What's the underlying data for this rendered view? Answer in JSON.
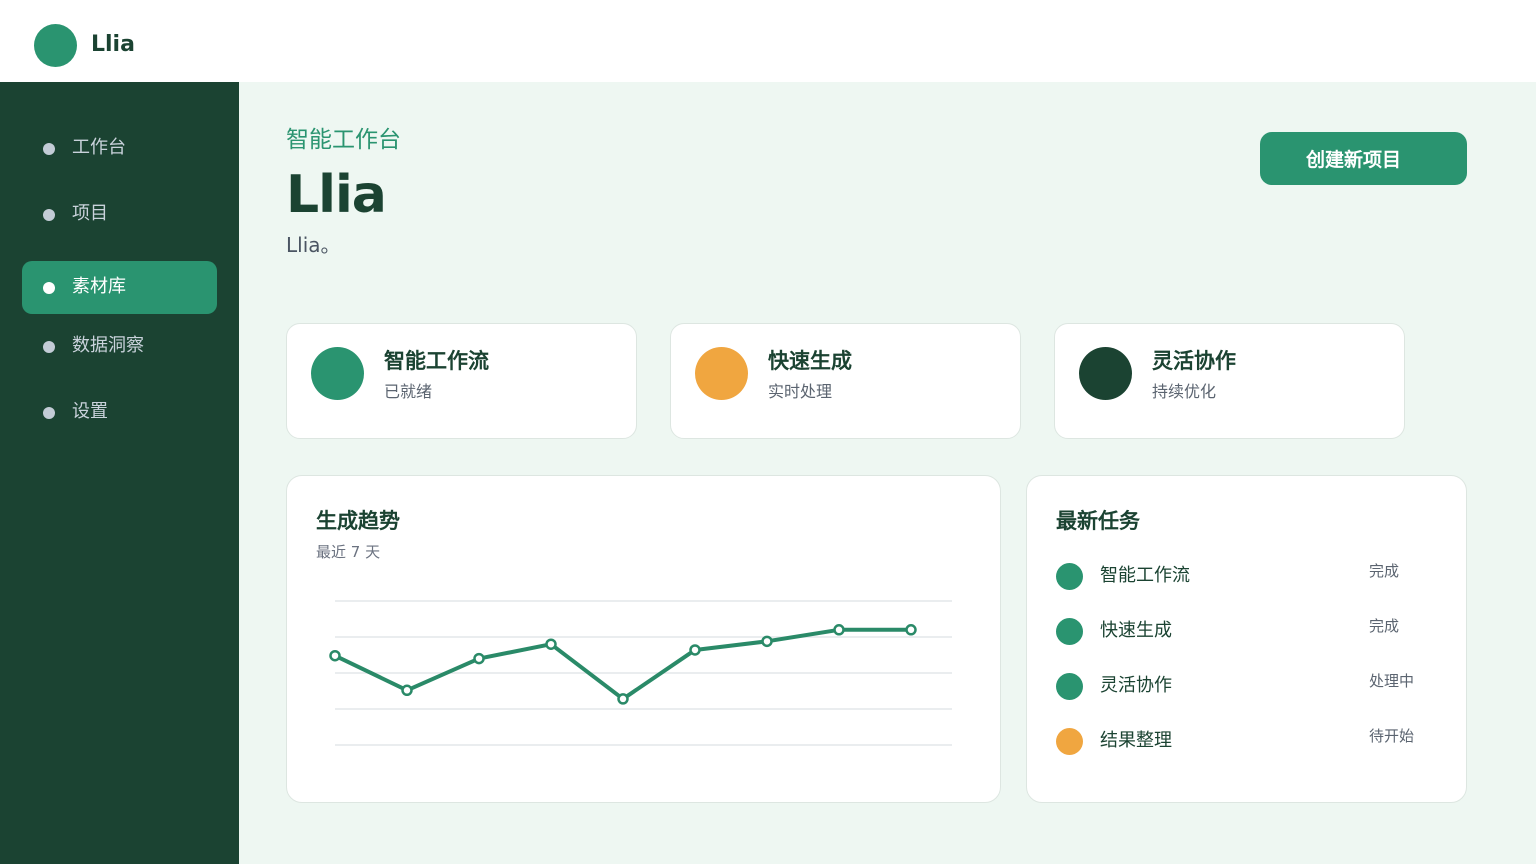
{
  "brand": {
    "name": "Llia"
  },
  "sidebar": {
    "items": [
      {
        "label": "工作台",
        "active": false
      },
      {
        "label": "项目",
        "active": false
      },
      {
        "label": "素材库",
        "active": true
      },
      {
        "label": "数据洞察",
        "active": false
      },
      {
        "label": "设置",
        "active": false
      }
    ]
  },
  "hero": {
    "kicker": "智能工作台",
    "title": "Llia",
    "subtitle": "Llia。"
  },
  "actions": {
    "create_label": "创建新项目"
  },
  "stats": [
    {
      "title": "智能工作流",
      "subtitle": "已就绪",
      "color": "#2a9470"
    },
    {
      "title": "快速生成",
      "subtitle": "实时处理",
      "color": "#f0a640"
    },
    {
      "title": "灵活协作",
      "subtitle": "持续优化",
      "color": "#1b4332"
    }
  ],
  "trend": {
    "title": "生成趋势",
    "subtitle": "最近 7 天"
  },
  "chart_data": {
    "type": "line",
    "title": "生成趋势",
    "subtitle": "最近 7 天",
    "x": [
      1,
      2,
      3,
      4,
      5,
      6,
      7,
      8,
      9
    ],
    "series": [
      {
        "values": [
          62,
          38,
          60,
          70,
          32,
          66,
          72,
          80,
          80
        ],
        "color": "#2a8a68"
      }
    ],
    "ylim": [
      0,
      100
    ],
    "grid": true,
    "gridlines": 5
  },
  "tasks": {
    "title": "最新任务",
    "items": [
      {
        "name": "智能工作流",
        "status": "完成",
        "color": "#2a9470"
      },
      {
        "name": "快速生成",
        "status": "完成",
        "color": "#2a9470"
      },
      {
        "name": "灵活协作",
        "status": "处理中",
        "color": "#2a9470"
      },
      {
        "name": "结果整理",
        "status": "待开始",
        "color": "#f0a640"
      }
    ]
  }
}
